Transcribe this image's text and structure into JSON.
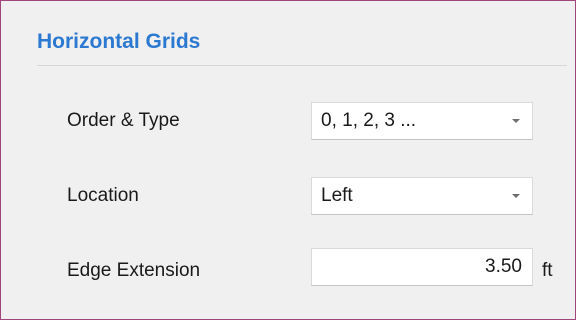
{
  "section": {
    "title": "Horizontal Grids"
  },
  "fields": {
    "order_type": {
      "label": "Order & Type",
      "value": "0, 1, 2, 3 ..."
    },
    "location": {
      "label": "Location",
      "value": "Left"
    },
    "edge_extension": {
      "label": "Edge Extension",
      "value": "3.50",
      "unit": "ft"
    }
  },
  "icons": {
    "dropdown_arrow": "chevron-down-icon"
  },
  "colors": {
    "section_title": "#2b79d1",
    "panel_border": "#a0467a",
    "background": "#f0f0f0"
  }
}
